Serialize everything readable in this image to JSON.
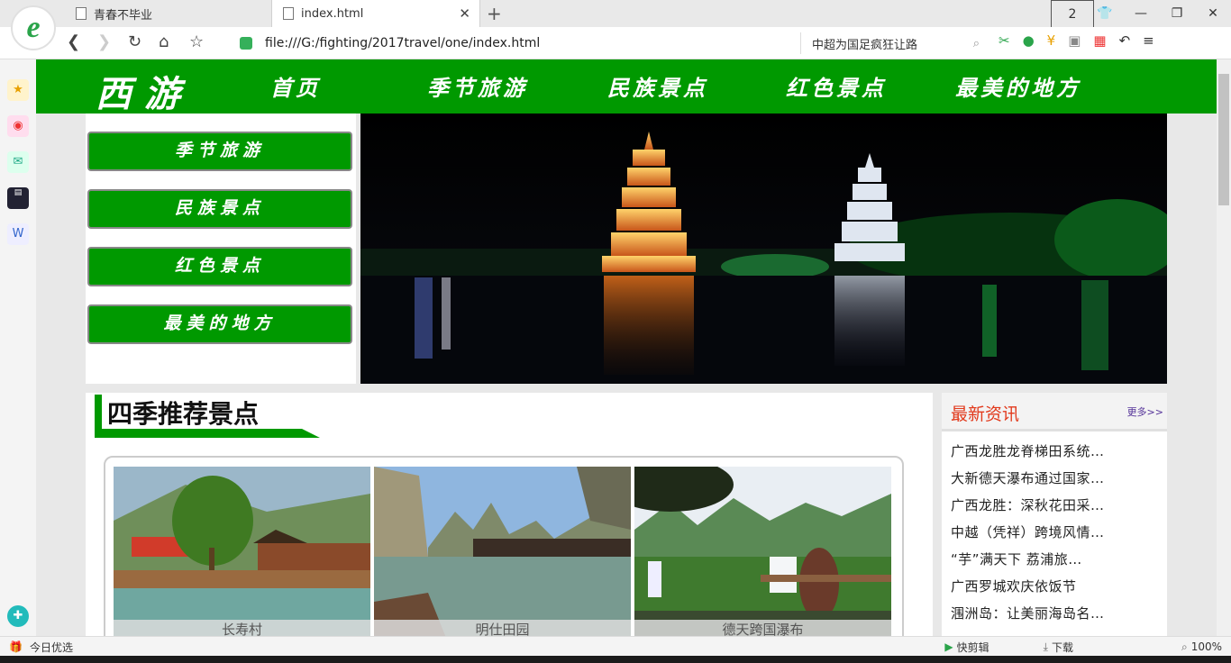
{
  "browser": {
    "tabs": [
      {
        "title": "青春不毕业"
      },
      {
        "title": "index.html"
      }
    ],
    "tab_count": "2",
    "url": "file:///G:/fighting/2017travel/one/index.html",
    "search_text": "中超为国足疯狂让路",
    "status_left": "今日优选",
    "status_right": [
      "快剪辑",
      "下载",
      "100%"
    ]
  },
  "site": {
    "logo": "西游",
    "nav": [
      "首页",
      "季节旅游",
      "民族景点",
      "红色景点",
      "最美的地方"
    ],
    "side_menu": [
      "季节旅游",
      "民族景点",
      "红色景点",
      "最美的地方"
    ],
    "section_title": "四季推荐景点",
    "cards": [
      {
        "caption": "长寿村"
      },
      {
        "caption": "明仕田园"
      },
      {
        "caption": "德天跨国瀑布"
      }
    ],
    "news": {
      "title": "最新资讯",
      "more": "更多>>",
      "items": [
        "广西龙胜龙脊梯田系统…",
        "大新德天瀑布通过国家…",
        "广西龙胜：深秋花田采…",
        "中越（凭祥）跨境风情…",
        "“芋”满天下 荔浦旅…",
        "广西罗城欢庆依饭节",
        "涠洲岛：让美丽海岛名…"
      ]
    }
  },
  "colors": {
    "brand_green": "#009900",
    "news_red": "#e23a1c"
  }
}
